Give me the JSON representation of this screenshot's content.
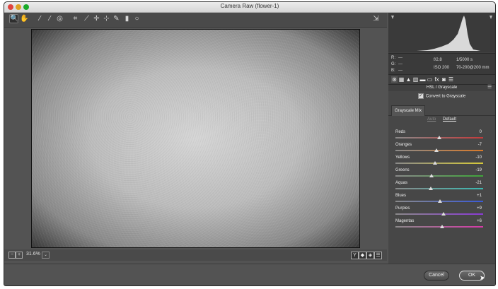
{
  "window": {
    "title": "Camera Raw (flower-1)"
  },
  "toolbar": {
    "tools": [
      {
        "icon": "zoom-icon",
        "glyph": "🔍",
        "active": true
      },
      {
        "icon": "hand-icon",
        "glyph": "✋",
        "active": false
      },
      {
        "icon": "white-balance-icon",
        "glyph": "⁄",
        "active": false
      },
      {
        "icon": "color-sampler-icon",
        "glyph": "⁄",
        "active": false
      },
      {
        "icon": "targeted-adjustment-icon",
        "glyph": "◎",
        "active": false
      },
      {
        "icon": "crop-icon",
        "glyph": "⌗",
        "active": false
      },
      {
        "icon": "straighten-icon",
        "glyph": "⟋",
        "active": false
      },
      {
        "icon": "spot-removal-icon",
        "glyph": "✛",
        "active": false
      },
      {
        "icon": "red-eye-icon",
        "glyph": "⊹",
        "active": false
      },
      {
        "icon": "adjustment-brush-icon",
        "glyph": "✎",
        "active": false
      },
      {
        "icon": "graduated-filter-icon",
        "glyph": "▮",
        "active": false
      },
      {
        "icon": "radial-filter-icon",
        "glyph": "○",
        "active": false
      }
    ],
    "export_icon": "⇲"
  },
  "bottombar": {
    "zoom": "31.6%",
    "zoom_dropdown": "⌄",
    "zoom_out": "−",
    "zoom_in": "+",
    "view_buttons": [
      "Y",
      "◆",
      "◈",
      "☰"
    ]
  },
  "info": {
    "r": "R:",
    "r_val": "---",
    "g": "G:",
    "g_val": "---",
    "b": "B:",
    "b_val": "---",
    "aperture": "f/2.8",
    "shutter": "1/5000 s",
    "iso": "ISO 200",
    "lens": "70-200@200 mm"
  },
  "panel_tabs": [
    {
      "icon": "basic-icon",
      "glyph": "⊛",
      "active": true
    },
    {
      "icon": "tone-curve-icon",
      "glyph": "▦",
      "active": false
    },
    {
      "icon": "detail-icon",
      "glyph": "▲",
      "active": false
    },
    {
      "icon": "hsl-icon",
      "glyph": "▥",
      "active": false
    },
    {
      "icon": "split-toning-icon",
      "glyph": "▬",
      "active": false
    },
    {
      "icon": "lens-icon",
      "glyph": "▭",
      "active": false
    },
    {
      "icon": "fx-icon",
      "glyph": "fx",
      "active": false
    },
    {
      "icon": "camera-calibration-icon",
      "glyph": "◙",
      "active": false
    },
    {
      "icon": "presets-icon",
      "glyph": "☰",
      "active": false
    }
  ],
  "panel": {
    "title": "HSL / Grayscale",
    "convert_label": "Convert to Grayscale",
    "convert_checked": "✓",
    "subtab": "Grayscale Mix",
    "auto": "Auto",
    "default": "Default",
    "sliders": [
      {
        "label": "Reds",
        "value": "0",
        "pos": 0.5,
        "track": "linear-gradient(90deg,#8a8a8a,#c43b3b)"
      },
      {
        "label": "Oranges",
        "value": "-7",
        "pos": 0.47,
        "track": "linear-gradient(90deg,#8a8a8a,#d97a2a)"
      },
      {
        "label": "Yellows",
        "value": "-10",
        "pos": 0.45,
        "track": "linear-gradient(90deg,#8a8a8a,#d6c93a)"
      },
      {
        "label": "Greens",
        "value": "-19",
        "pos": 0.41,
        "track": "linear-gradient(90deg,#8a8a8a,#3fa53a)"
      },
      {
        "label": "Aquas",
        "value": "-21",
        "pos": 0.4,
        "track": "linear-gradient(90deg,#8a8a8a,#3ab8b0)"
      },
      {
        "label": "Blues",
        "value": "+1",
        "pos": 0.51,
        "track": "linear-gradient(90deg,#8a8a8a,#3a5ad6)"
      },
      {
        "label": "Purples",
        "value": "+9",
        "pos": 0.55,
        "track": "linear-gradient(90deg,#8a8a8a,#8a3ad6)"
      },
      {
        "label": "Magentas",
        "value": "+6",
        "pos": 0.53,
        "track": "linear-gradient(90deg,#8a8a8a,#d63aa8)"
      }
    ]
  },
  "footer": {
    "cancel": "Cancel",
    "ok": "OK"
  }
}
